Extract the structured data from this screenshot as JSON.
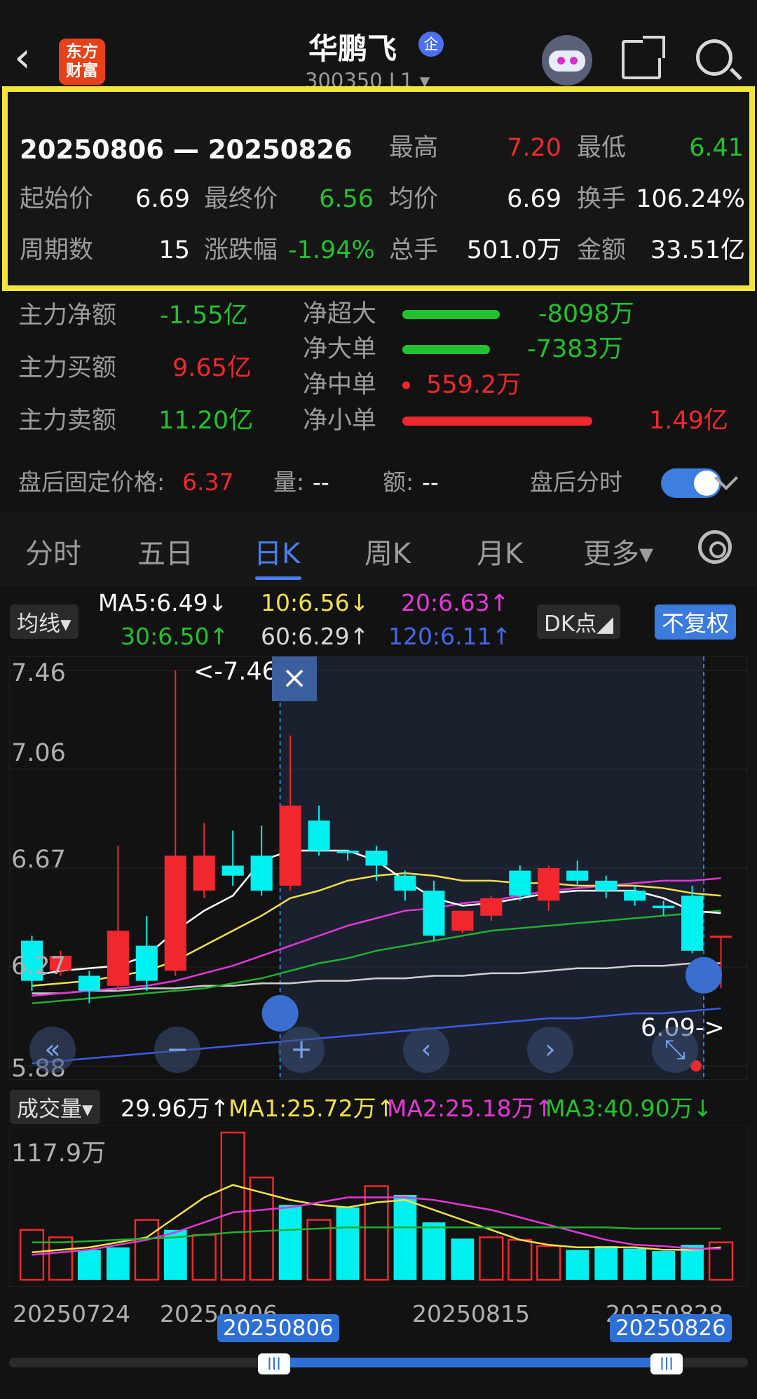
{
  "header": {
    "back": "‹",
    "logo": "东方\n财富",
    "title": "华鹏飞",
    "badge": "企",
    "code": "300350 L1 ▾"
  },
  "summary": {
    "date_range": "20250806 — 20250826",
    "high_label": "最高",
    "high": "7.20",
    "low_label": "最低",
    "low": "6.41",
    "open_label": "起始价",
    "open": "6.69",
    "close_label": "最终价",
    "close": "6.56",
    "avg_label": "均价",
    "avg": "6.69",
    "turn_label": "换手",
    "turn": "106.24%",
    "periods_label": "周期数",
    "periods": "15",
    "chg_label": "涨跌幅",
    "chg": "-1.94%",
    "vol_label": "总手",
    "vol": "501.0万",
    "amt_label": "金额",
    "amt": "33.51亿"
  },
  "fund": {
    "net_label": "主力净额",
    "net": "-1.55亿",
    "buy_label": "主力买额",
    "buy": "9.65亿",
    "sell_label": "主力卖额",
    "sell": "11.20亿",
    "xl_label": "净超大",
    "xl": "-8098万",
    "xl_frac": 0.42,
    "l_label": "净大单",
    "l": "-7383万",
    "l_frac": 0.38,
    "m_label": "净中单",
    "m": "559.2万",
    "s_label": "净小单",
    "s": "1.49亿",
    "s_frac": 0.82
  },
  "after_hours": {
    "price_label": "盘后固定价格:",
    "price": "6.37",
    "vol_label": "量:",
    "vol": "--",
    "amt_label": "额:",
    "amt": "--",
    "toggle_label": "盘后分时"
  },
  "tabs": [
    "分时",
    "五日",
    "日K",
    "周K",
    "月K",
    "更多▾"
  ],
  "ma_row": {
    "pill": "均线▾",
    "ma5": "MA5:6.49↓",
    "ma10": "10:6.56↓",
    "ma20": "20:6.63↑",
    "ma30": "30:6.50↑",
    "ma60": "60:6.29↑",
    "ma120": "120:6.11↑",
    "dk": "DK点◢",
    "adj": "不复权"
  },
  "kchart": {
    "y_labels": [
      "7.46",
      "7.06",
      "6.67",
      "6.27",
      "5.88"
    ],
    "high_marker": "<-7.46",
    "low_marker": "6.09->",
    "close_icon": "×"
  },
  "volume": {
    "pill": "成交量▾",
    "vol": "29.96万↑",
    "ma1": "MA1:25.72万↑",
    "ma2": "MA2:25.18万↑",
    "ma3": "MA3:40.90万↓",
    "y_label": "117.9万"
  },
  "dates": {
    "d1": "20250724",
    "d2": "20250806",
    "d3": "20250815",
    "d4": "20250828",
    "sel_start": "20250806",
    "sel_end": "20250826"
  },
  "colors": {
    "up": "#f0282d",
    "down": "#00f0f0",
    "ma5": "#ffffff",
    "ma10": "#f2e14a",
    "ma20": "#e438d8",
    "ma30": "#22b02e",
    "ma60": "#d0d0d0",
    "ma120": "#3a5ee8",
    "accent": "#3d7fe0",
    "frame": "#f2e43a"
  },
  "chart_data": {
    "type": "candlestick",
    "ylim": [
      5.88,
      7.46
    ],
    "candles": [
      {
        "o": 6.38,
        "c": 6.22,
        "h": 6.4,
        "l": 6.18
      },
      {
        "o": 6.26,
        "c": 6.32,
        "h": 6.34,
        "l": 6.24
      },
      {
        "o": 6.24,
        "c": 6.18,
        "h": 6.26,
        "l": 6.13
      },
      {
        "o": 6.2,
        "c": 6.42,
        "h": 6.76,
        "l": 6.18
      },
      {
        "o": 6.36,
        "c": 6.22,
        "h": 6.48,
        "l": 6.18
      },
      {
        "o": 6.26,
        "c": 6.72,
        "h": 7.46,
        "l": 6.24
      },
      {
        "o": 6.58,
        "c": 6.72,
        "h": 6.85,
        "l": 6.55
      },
      {
        "o": 6.68,
        "c": 6.64,
        "h": 6.82,
        "l": 6.6
      },
      {
        "o": 6.72,
        "c": 6.58,
        "h": 6.84,
        "l": 6.56
      },
      {
        "o": 6.6,
        "c": 6.92,
        "h": 7.2,
        "l": 6.58
      },
      {
        "o": 6.86,
        "c": 6.74,
        "h": 6.92,
        "l": 6.72
      },
      {
        "o": 6.74,
        "c": 6.73,
        "h": 6.74,
        "l": 6.7
      },
      {
        "o": 6.74,
        "c": 6.68,
        "h": 6.76,
        "l": 6.62
      },
      {
        "o": 6.64,
        "c": 6.58,
        "h": 6.66,
        "l": 6.54
      },
      {
        "o": 6.58,
        "c": 6.4,
        "h": 6.62,
        "l": 6.38
      },
      {
        "o": 6.42,
        "c": 6.5,
        "h": 6.5,
        "l": 6.41
      },
      {
        "o": 6.48,
        "c": 6.55,
        "h": 6.56,
        "l": 6.46
      },
      {
        "o": 6.66,
        "c": 6.56,
        "h": 6.68,
        "l": 6.54
      },
      {
        "o": 6.54,
        "c": 6.67,
        "h": 6.68,
        "l": 6.5
      },
      {
        "o": 6.66,
        "c": 6.62,
        "h": 6.7,
        "l": 6.6
      },
      {
        "o": 6.62,
        "c": 6.58,
        "h": 6.64,
        "l": 6.55
      },
      {
        "o": 6.58,
        "c": 6.54,
        "h": 6.6,
        "l": 6.52
      },
      {
        "o": 6.52,
        "c": 6.51,
        "h": 6.54,
        "l": 6.48
      },
      {
        "o": 6.56,
        "c": 6.34,
        "h": 6.6,
        "l": 6.33
      },
      {
        "o": 6.4,
        "c": 6.4,
        "h": 6.4,
        "l": 6.19
      }
    ],
    "volumes": [
      40,
      34,
      24,
      26,
      48,
      40,
      36,
      118,
      82,
      60,
      48,
      58,
      75,
      68,
      46,
      33,
      34,
      32,
      27,
      24,
      27,
      25,
      23,
      28,
      30
    ],
    "vol_up": [
      true,
      true,
      false,
      false,
      true,
      false,
      true,
      true,
      true,
      false,
      true,
      false,
      true,
      false,
      false,
      false,
      true,
      true,
      true,
      false,
      false,
      false,
      false,
      false,
      true
    ],
    "ma5": [
      6.24,
      6.26,
      6.27,
      6.28,
      6.32,
      6.42,
      6.5,
      6.56,
      6.7,
      6.74,
      6.74,
      6.74,
      6.7,
      6.62,
      6.55,
      6.52,
      6.53,
      6.55,
      6.57,
      6.58,
      6.58,
      6.58,
      6.55,
      6.5,
      6.49
    ],
    "ma10": [
      6.2,
      6.21,
      6.22,
      6.24,
      6.26,
      6.3,
      6.36,
      6.42,
      6.48,
      6.55,
      6.58,
      6.62,
      6.64,
      6.65,
      6.64,
      6.62,
      6.62,
      6.61,
      6.61,
      6.6,
      6.6,
      6.6,
      6.59,
      6.57,
      6.56
    ],
    "ma20": [
      6.16,
      6.17,
      6.18,
      6.19,
      6.2,
      6.22,
      6.25,
      6.28,
      6.32,
      6.36,
      6.4,
      6.44,
      6.47,
      6.5,
      6.51,
      6.53,
      6.54,
      6.56,
      6.58,
      6.59,
      6.6,
      6.61,
      6.62,
      6.62,
      6.63
    ],
    "ma30": [
      6.13,
      6.14,
      6.15,
      6.16,
      6.17,
      6.18,
      6.19,
      6.21,
      6.23,
      6.26,
      6.29,
      6.31,
      6.34,
      6.36,
      6.38,
      6.4,
      6.42,
      6.43,
      6.44,
      6.45,
      6.46,
      6.47,
      6.48,
      6.49,
      6.5
    ],
    "ma60": [
      6.17,
      6.17,
      6.18,
      6.18,
      6.19,
      6.19,
      6.2,
      6.2,
      6.21,
      6.21,
      6.22,
      6.22,
      6.23,
      6.23,
      6.24,
      6.24,
      6.25,
      6.25,
      6.26,
      6.27,
      6.27,
      6.28,
      6.28,
      6.29,
      6.29
    ],
    "ma120": [
      5.89,
      5.9,
      5.91,
      5.92,
      5.93,
      5.94,
      5.95,
      5.96,
      5.97,
      5.98,
      5.99,
      6.0,
      6.01,
      6.02,
      6.03,
      6.04,
      6.05,
      6.06,
      6.07,
      6.07,
      6.08,
      6.09,
      6.09,
      6.1,
      6.11
    ],
    "vol_ma1": [
      22,
      24,
      26,
      30,
      34,
      50,
      66,
      76,
      70,
      64,
      60,
      58,
      62,
      64,
      56,
      48,
      40,
      32,
      28,
      26,
      26,
      26,
      24,
      24,
      26
    ],
    "vol_ma2": [
      20,
      22,
      24,
      28,
      32,
      38,
      46,
      54,
      56,
      58,
      62,
      66,
      66,
      66,
      64,
      60,
      56,
      50,
      44,
      38,
      32,
      28,
      27,
      25,
      25
    ],
    "vol_ma3": [
      30,
      30,
      31,
      32,
      33,
      34,
      36,
      38,
      39,
      40,
      41,
      42,
      42,
      42,
      42,
      42,
      42,
      42,
      42,
      42,
      42,
      41,
      41,
      41,
      41
    ],
    "selection": {
      "start_index": 9,
      "end_index": 23
    }
  }
}
